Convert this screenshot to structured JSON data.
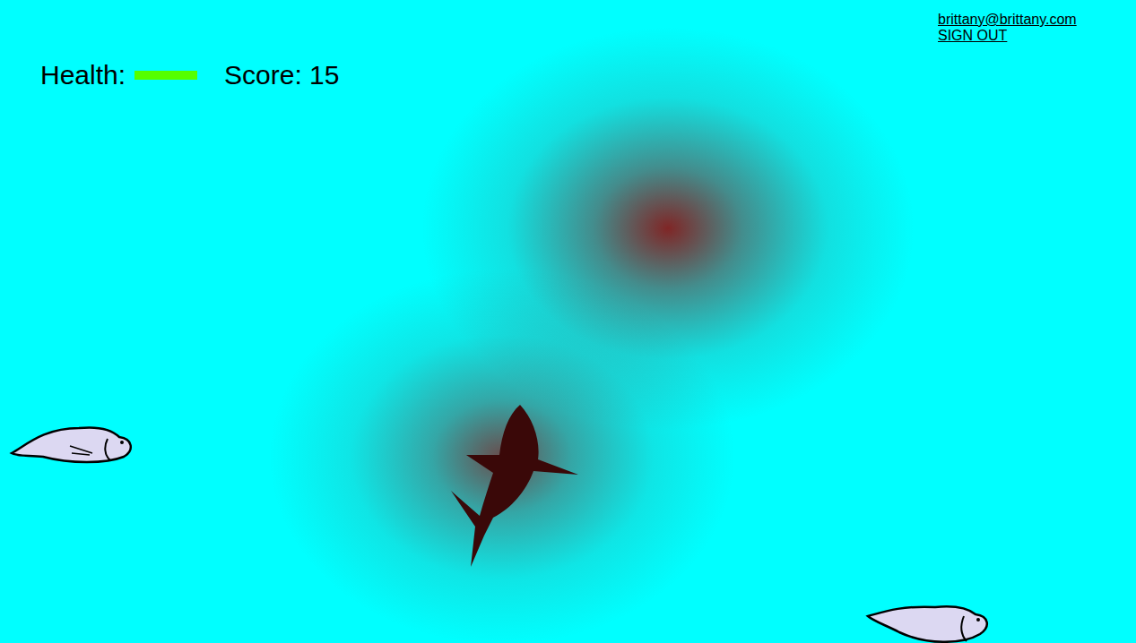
{
  "account": {
    "email": "brittany@brittany.com",
    "sign_out": "SIGN OUT"
  },
  "hud": {
    "health_label": "Health:",
    "health_level": 1,
    "score": "Score: 15"
  }
}
